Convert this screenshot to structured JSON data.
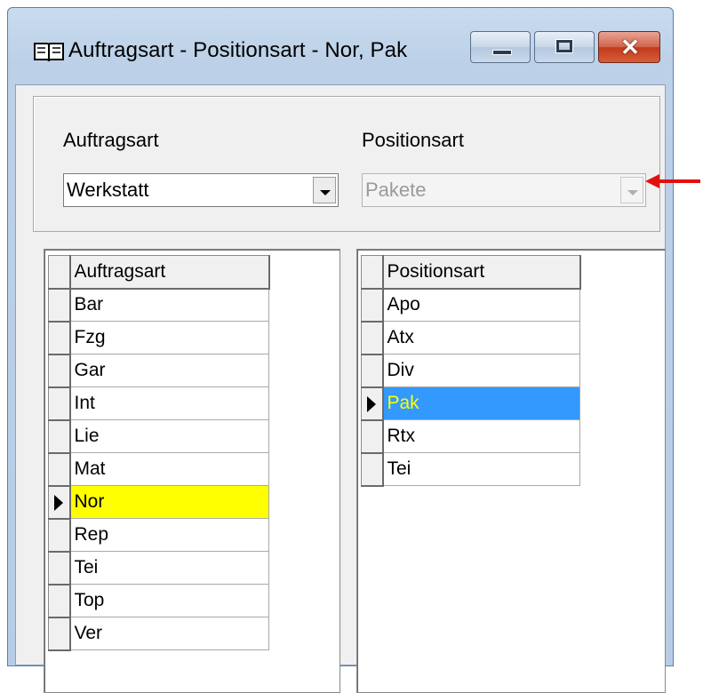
{
  "window": {
    "title": "Auftragsart - Positionsart - Nor, Pak",
    "icon": "book-icon",
    "buttons": {
      "minimize": "minimize-icon",
      "maximize": "maximize-icon",
      "close": "close-icon",
      "close_glyph": "✕"
    }
  },
  "filters": {
    "auftragsart_label": "Auftragsart",
    "auftragsart_value": "Werkstatt",
    "positionsart_label": "Positionsart",
    "positionsart_value": "Pakete"
  },
  "grid_auftragsart": {
    "header": "Auftragsart",
    "rows": [
      "Bar",
      "Fzg",
      "Gar",
      "Int",
      "Lie",
      "Mat",
      "Nor",
      "Rep",
      "Tei",
      "Top",
      "Ver"
    ],
    "selected": "Nor"
  },
  "grid_positionsart": {
    "header": "Positionsart",
    "rows": [
      "Apo",
      "Atx",
      "Div",
      "Pak",
      "Rtx",
      "Tei"
    ],
    "selected": "Pak"
  },
  "annotation": {
    "arrow_color": "#e01010"
  },
  "colors": {
    "selected_yellow": "#ffff00",
    "selected_blue": "#3399ff",
    "selected_blue_text": "#ffff00"
  }
}
